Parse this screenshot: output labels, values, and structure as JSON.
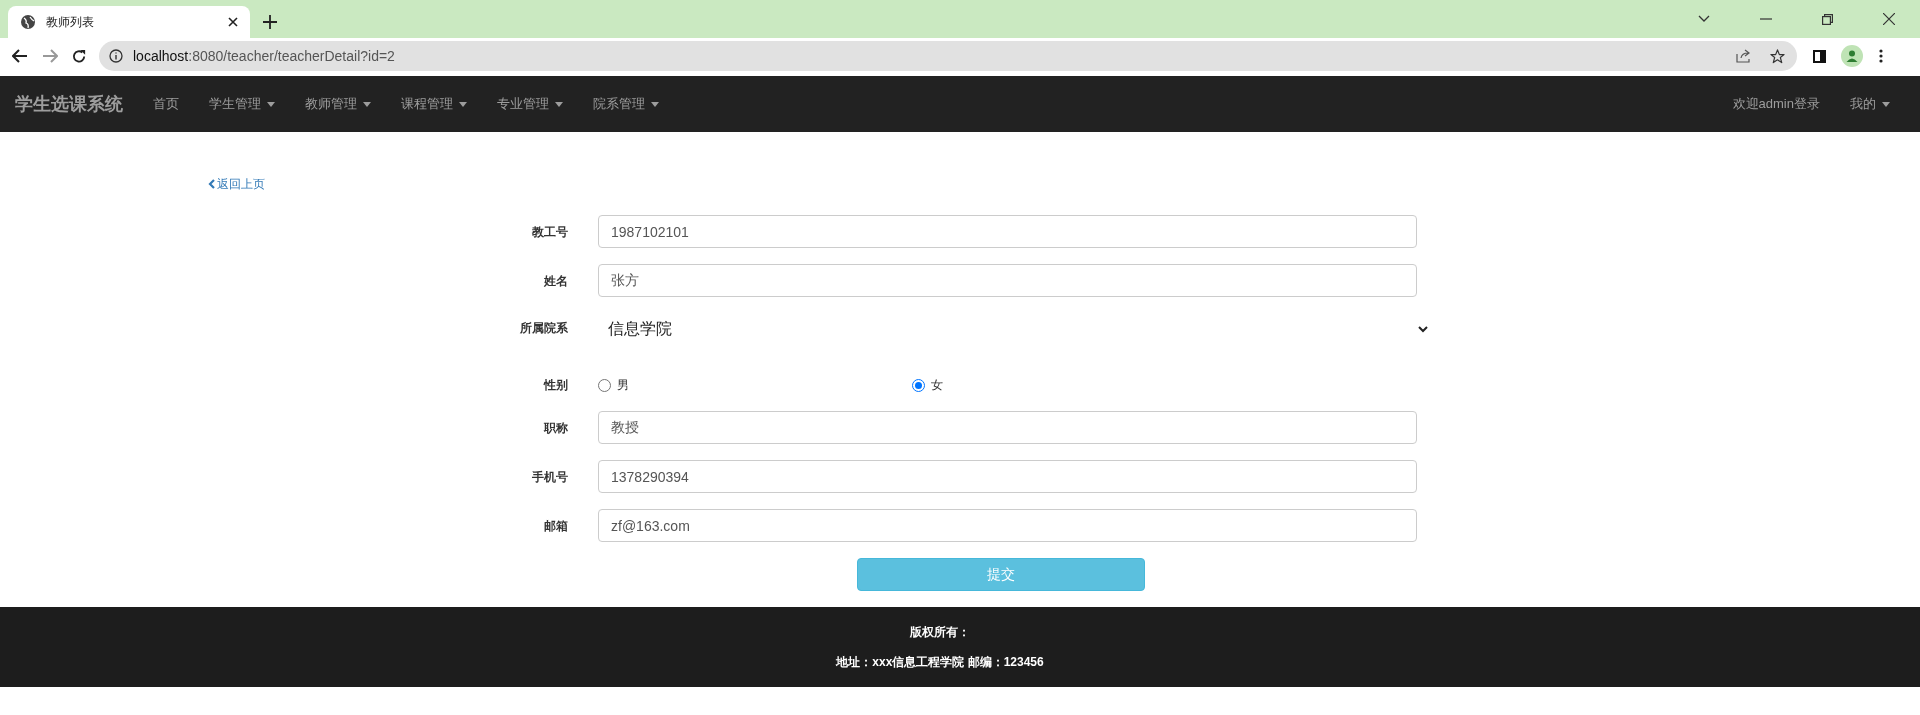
{
  "browser": {
    "tab_title": "教师列表",
    "url_host": "localhost",
    "url_rest": ":8080/teacher/teacherDetail?id=2"
  },
  "navbar": {
    "brand": "学生选课系统",
    "items": [
      {
        "label": "首页",
        "dropdown": false
      },
      {
        "label": "学生管理",
        "dropdown": true
      },
      {
        "label": "教师管理",
        "dropdown": true
      },
      {
        "label": "课程管理",
        "dropdown": true
      },
      {
        "label": "专业管理",
        "dropdown": true
      },
      {
        "label": "院系管理",
        "dropdown": true
      }
    ],
    "right_items": [
      {
        "label": "欢迎admin登录",
        "dropdown": false
      },
      {
        "label": "我的",
        "dropdown": true
      }
    ]
  },
  "back_link": "返回上页",
  "form": {
    "fields": [
      {
        "kind": "text",
        "label": "教工号",
        "value": "1987102101"
      },
      {
        "kind": "text",
        "label": "姓名",
        "value": "张方"
      },
      {
        "kind": "select",
        "label": "所属院系",
        "value": "信息学院"
      },
      {
        "kind": "radio",
        "label": "性别",
        "options": [
          {
            "label": "男",
            "selected": false
          },
          {
            "label": "女",
            "selected": true
          }
        ]
      },
      {
        "kind": "text",
        "label": "职称",
        "value": "教授"
      },
      {
        "kind": "text",
        "label": "手机号",
        "value": "1378290394"
      },
      {
        "kind": "text",
        "label": "邮箱",
        "value": "zf@163.com"
      }
    ],
    "submit": "提交"
  },
  "footer": {
    "lines": [
      "版权所有：",
      "地址：xxx信息工程学院 邮编：123456"
    ]
  }
}
